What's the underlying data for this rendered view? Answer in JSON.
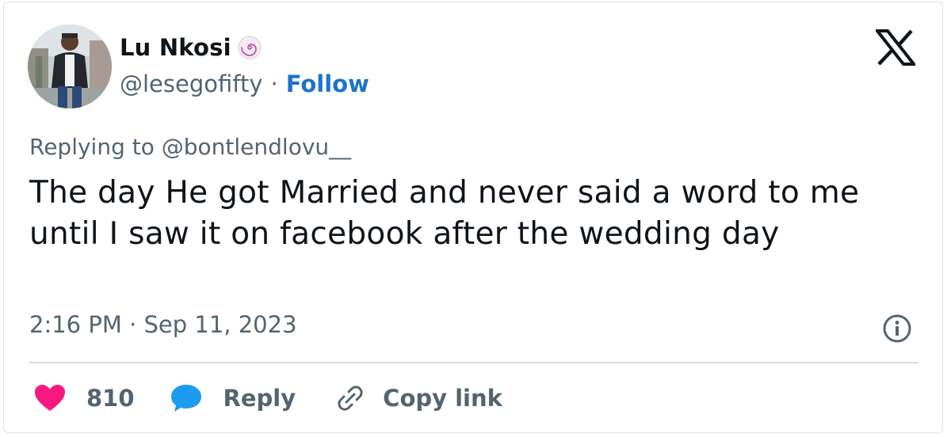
{
  "author": {
    "name": "Lu Nkosi",
    "handle": "@lesegofifty",
    "separator": "·",
    "follow_label": "Follow",
    "badge_icon": "spiral-badge-icon"
  },
  "brand": {
    "logo_icon": "x-logo-icon"
  },
  "reply_context": {
    "prefix": "Replying to",
    "mention": "@bontlendlovu__"
  },
  "tweet": {
    "text": "The day He got Married and never said a word to me until I saw it on facebook after the wedding day",
    "timestamp": "2:16 PM · Sep 11, 2023"
  },
  "actions": {
    "like_count": "810",
    "reply_label": "Reply",
    "copy_label": "Copy link"
  },
  "colors": {
    "follow": "#1d74c9",
    "like": "#f91880",
    "reply": "#1d9bf0",
    "muted": "#536471",
    "text": "#0f1419"
  }
}
